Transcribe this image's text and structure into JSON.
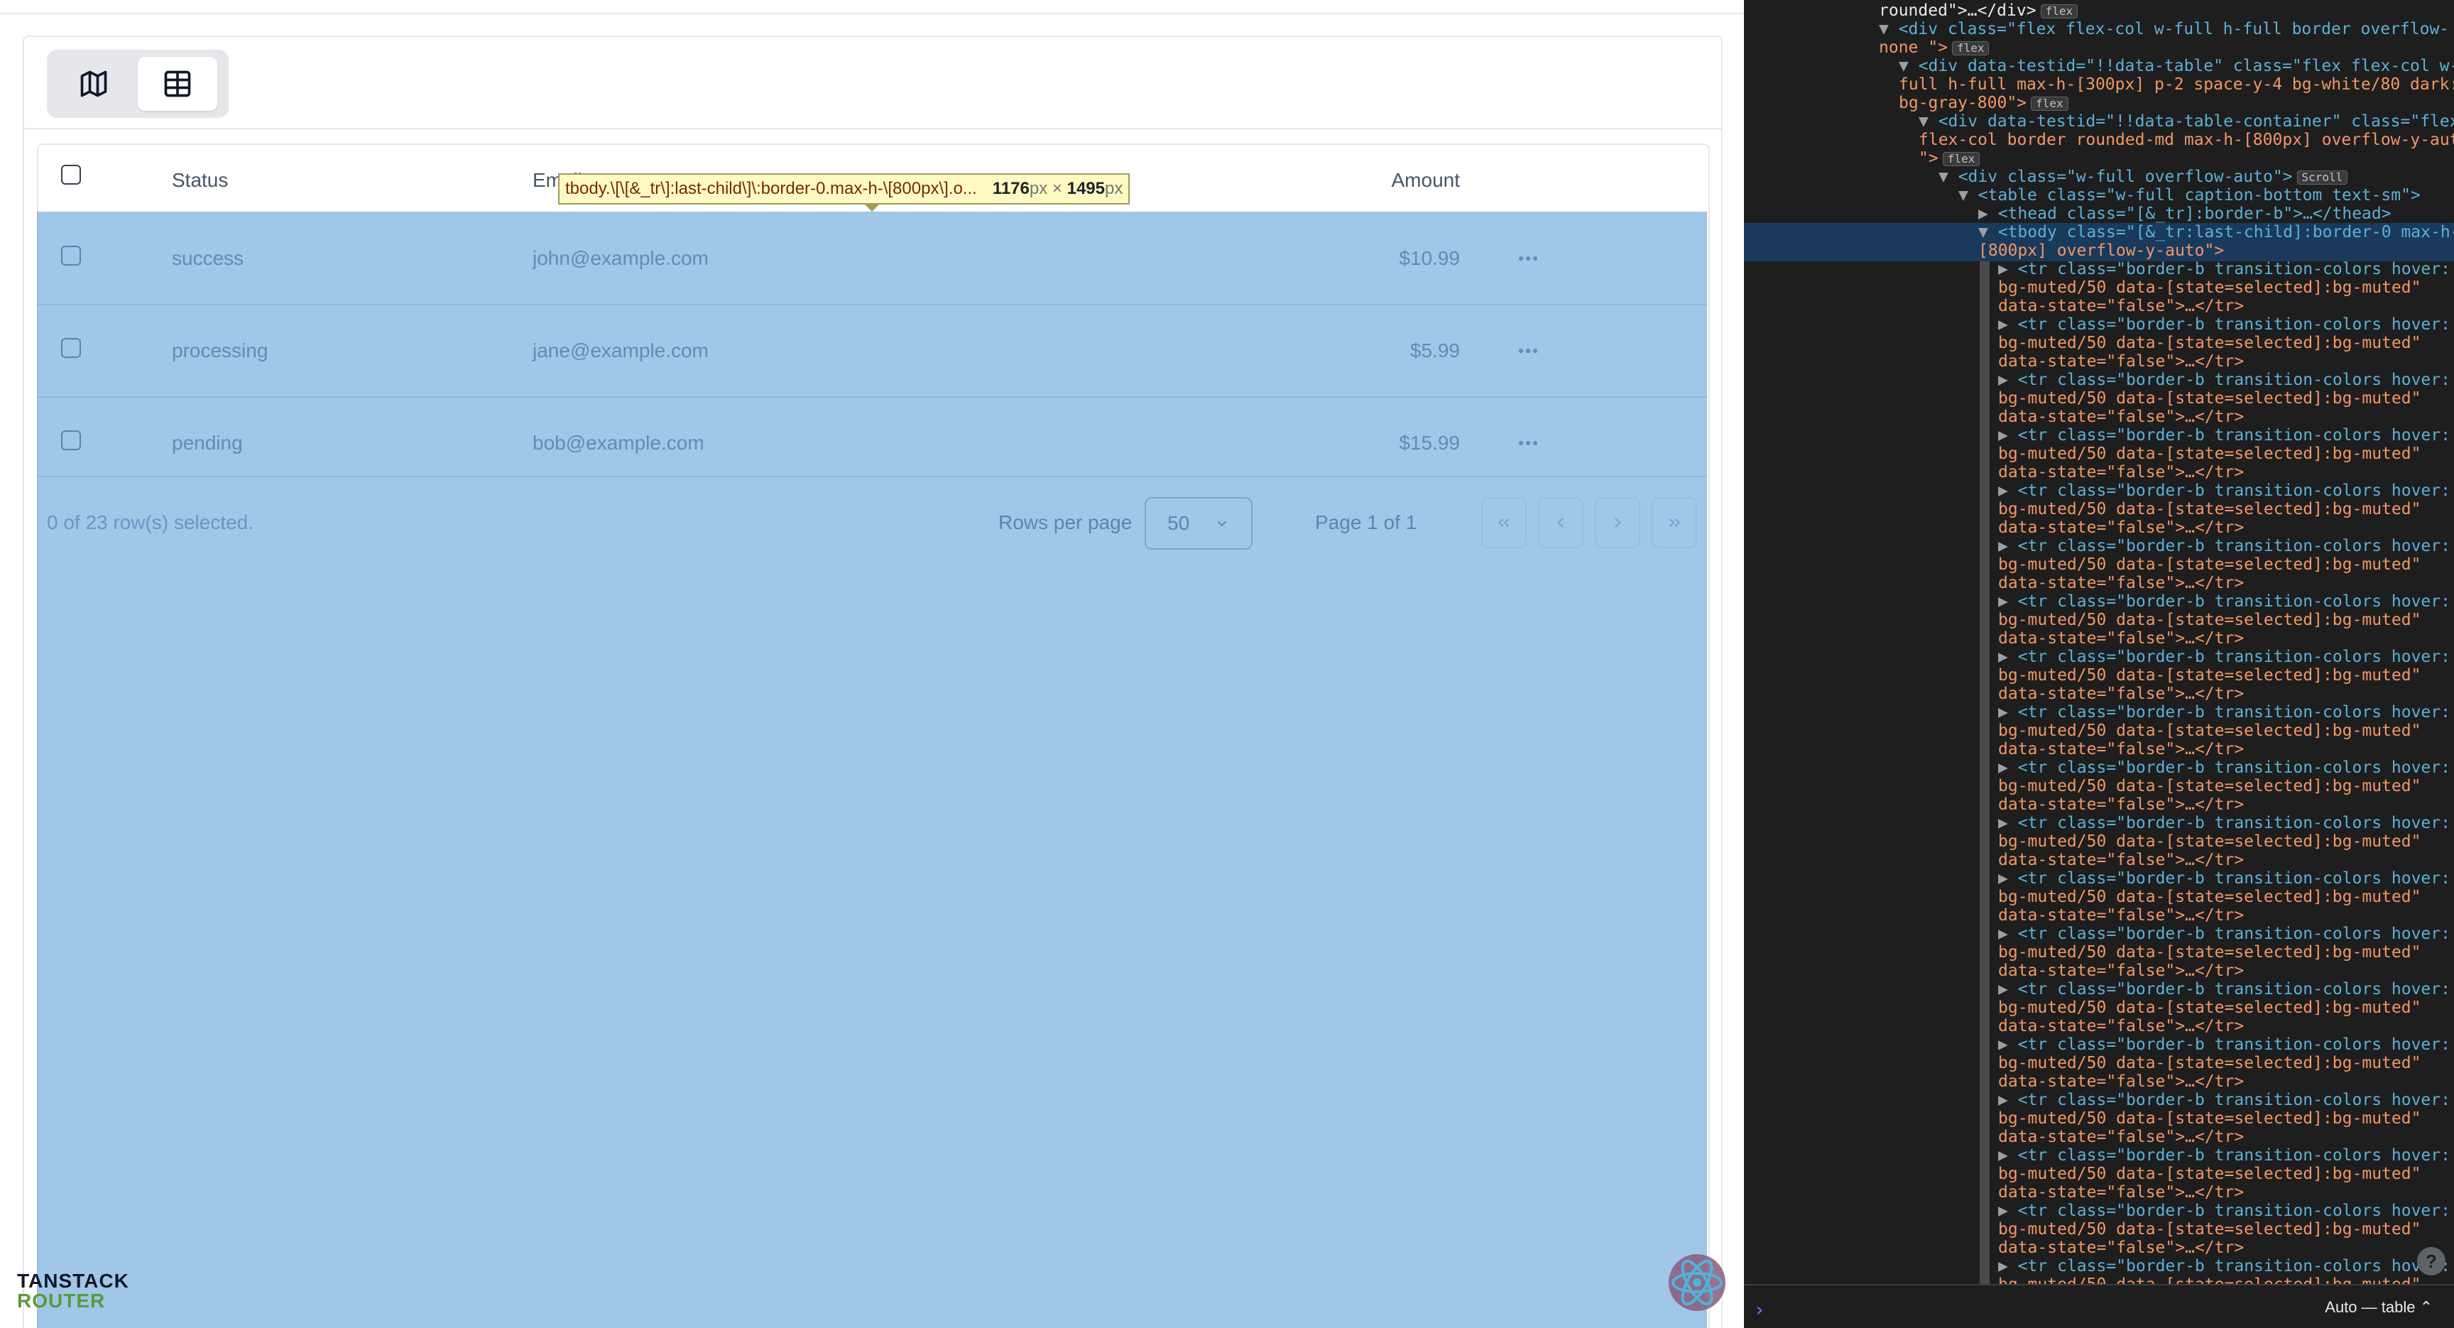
{
  "toolbar": {
    "map_view_icon": "map-icon",
    "table_view_icon": "table-icon"
  },
  "table": {
    "headers": {
      "status": "Status",
      "email": "Email",
      "amount": "Amount"
    },
    "rows": [
      {
        "status": "success",
        "email": "john@example.com",
        "amount": "$10.99"
      },
      {
        "status": "processing",
        "email": "jane@example.com",
        "amount": "$5.99"
      },
      {
        "status": "pending",
        "email": "bob@example.com",
        "amount": "$15.99"
      }
    ]
  },
  "footer": {
    "selected_text": "0 of 23 row(s) selected.",
    "rows_per_page_label": "Rows per page",
    "rows_per_page_value": "50",
    "page_indicator": "Page 1 of 1"
  },
  "inspector_tooltip": {
    "selector": "tbody.\\[\\[&_tr\\]:last-child\\]\\:border-0.max-h-\\[800px\\].o...",
    "width": "1176",
    "height": "1495",
    "unit": "px",
    "times": "×"
  },
  "brand": {
    "line1": "TANSTACK",
    "line2": "ROUTER"
  },
  "devtools": {
    "lines": {
      "l0": "rounded\">…</div>",
      "l1a": "<div class=\"flex flex-col w-full h-full border overflow-",
      "l1b": "none \">",
      "l2a": "<div data-testid=\"!!data-table\" class=\"flex flex-col w-",
      "l2b": "full h-full max-h-[300px] p-2 space-y-4 bg-white/80 dark:",
      "l2c": "bg-gray-800\">",
      "l3a": "<div data-testid=\"!!data-table-container\" class=\"flex",
      "l3b": "flex-col border rounded-md max-h-[800px] overflow-y-auto",
      "l3c": "\">",
      "l4": "<div class=\"w-full overflow-auto\">",
      "l5": "<table class=\"w-full caption-bottom text-sm\">",
      "l6": "<thead class=\"[&_tr]:border-b\">…</thead>",
      "l7a": "<tbody class=\"[&_tr:last-child]:border-0 max-h-",
      "l7b": "[800px] overflow-y-auto\">",
      "tr_a": "<tr class=\"border-b transition-colors hover:",
      "tr_b": "bg-muted/50 data-[state=selected]:bg-muted\"",
      "tr_c": "data-state=\"false\">…</tr>"
    },
    "badges": {
      "flex": "flex",
      "scroll": "Scroll"
    },
    "mode_label": "Auto — table",
    "help": "?"
  }
}
